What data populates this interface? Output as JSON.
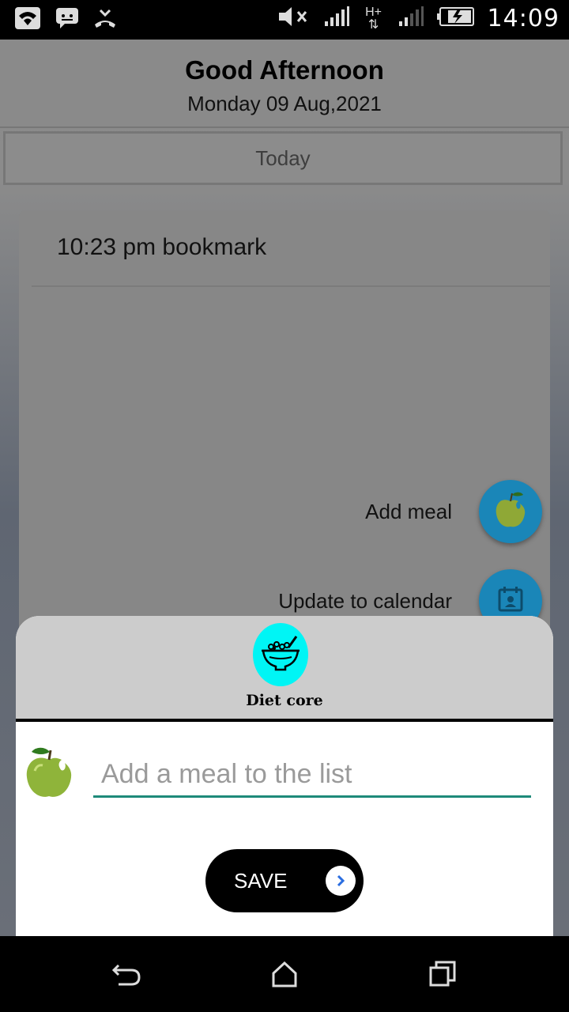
{
  "status_bar": {
    "time": "14:09",
    "network_label": "H+",
    "icons": [
      "wifi-icon",
      "message-icon",
      "missed-call-icon",
      "mute-icon",
      "signal-icon",
      "data-icon",
      "signal-icon",
      "battery-charging-icon"
    ]
  },
  "header": {
    "greeting": "Good Afternoon",
    "date": "Monday 09 Aug,2021"
  },
  "tabs": {
    "today_label": "Today"
  },
  "card": {
    "entry": "10:23 pm bookmark"
  },
  "fab_menu": {
    "add_meal_label": "Add meal",
    "update_calendar_label": "Update to calendar"
  },
  "sheet": {
    "brand": "Diet core",
    "input_placeholder": "Add a meal to the list",
    "input_value": "",
    "save_label": "SAVE"
  },
  "colors": {
    "fab": "#1a86b8",
    "logo_bg": "#00f5f5",
    "input_underline": "#1e8a7a",
    "sheet_header": "#cccccc"
  }
}
